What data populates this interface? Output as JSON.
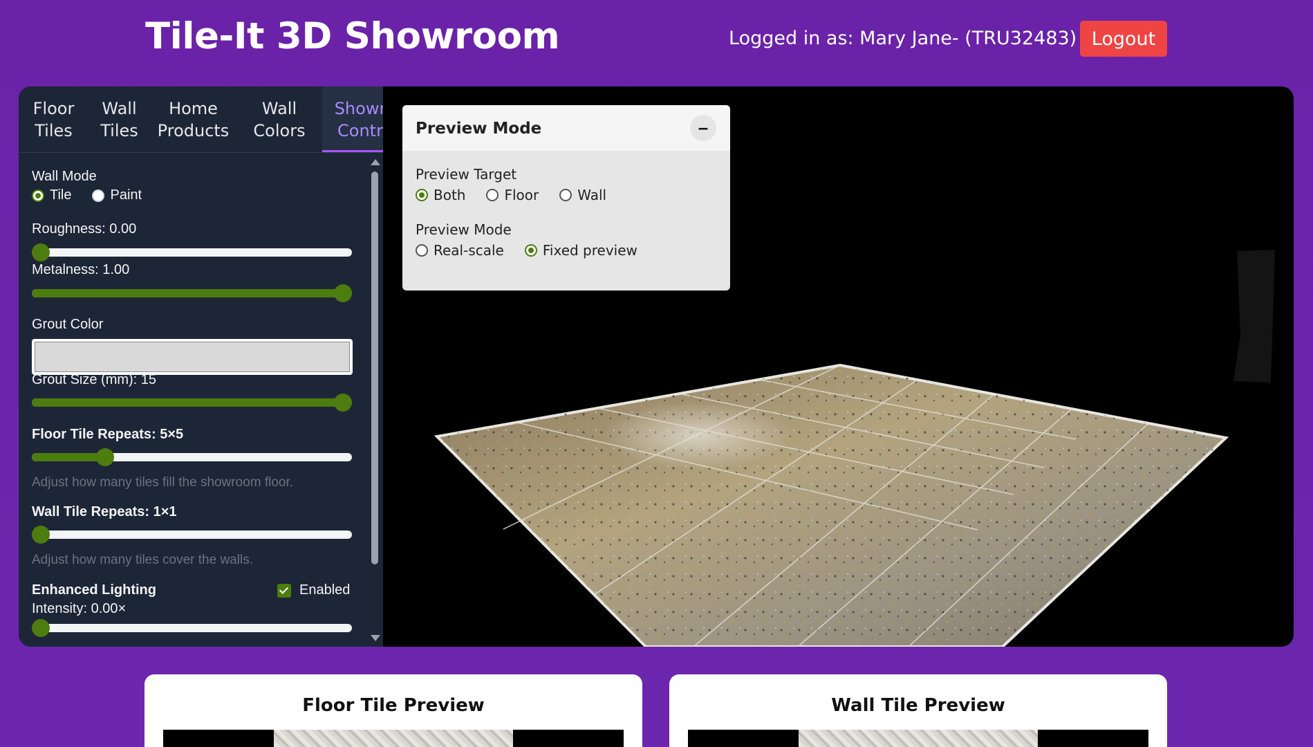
{
  "header": {
    "title": "Tile-It 3D Showroom",
    "user": "Logged in as: Mary Jane- (TRU32483)",
    "logout_label": "Logout"
  },
  "tabs": [
    {
      "label": "Floor\nTiles"
    },
    {
      "label": "Wall\nTiles"
    },
    {
      "label": "Home\nProducts"
    },
    {
      "label": "Wall\nColors"
    },
    {
      "label": "Showr\nContr"
    }
  ],
  "controls": {
    "wall_mode_label": "Wall Mode",
    "wall_mode_options": [
      "Tile",
      "Paint"
    ],
    "wall_mode_selected": "Tile",
    "roughness_label": "Roughness: 0.00",
    "roughness_value": 0.0,
    "metalness_label": "Metalness: 1.00",
    "metalness_value": 1.0,
    "grout_color_label": "Grout Color",
    "grout_color": "#d9d9d9",
    "grout_size_label": "Grout Size (mm): 15",
    "grout_size_fraction": 1.0,
    "floor_repeats_label": "Floor Tile Repeats: 5×5",
    "floor_repeats_fraction": 0.23,
    "floor_repeats_hint": "Adjust how many tiles fill the showroom floor.",
    "wall_repeats_label": "Wall Tile Repeats: 1×1",
    "wall_repeats_fraction": 0.0,
    "wall_repeats_hint": "Adjust how many tiles cover the walls.",
    "lighting_label": "Enhanced Lighting",
    "lighting_enabled_label": "Enabled",
    "lighting_enabled": true,
    "intensity_label": "Intensity: 0.00×",
    "intensity_value": 0.0
  },
  "preview_panel": {
    "title": "Preview Mode",
    "minimize_glyph": "–",
    "target_label": "Preview Target",
    "target_options": [
      "Both",
      "Floor",
      "Wall"
    ],
    "target_selected": "Both",
    "mode_label": "Preview Mode",
    "mode_options": [
      "Real-scale",
      "Fixed preview"
    ],
    "mode_selected": "Fixed preview"
  },
  "cards": {
    "floor_title": "Floor Tile Preview",
    "wall_title": "Wall Tile Preview"
  },
  "colors": {
    "accent_green": "#4d7c0f",
    "logout_red": "#ef4444",
    "active_tab": "#a78bfa",
    "background_purple": "#6b25ac"
  }
}
